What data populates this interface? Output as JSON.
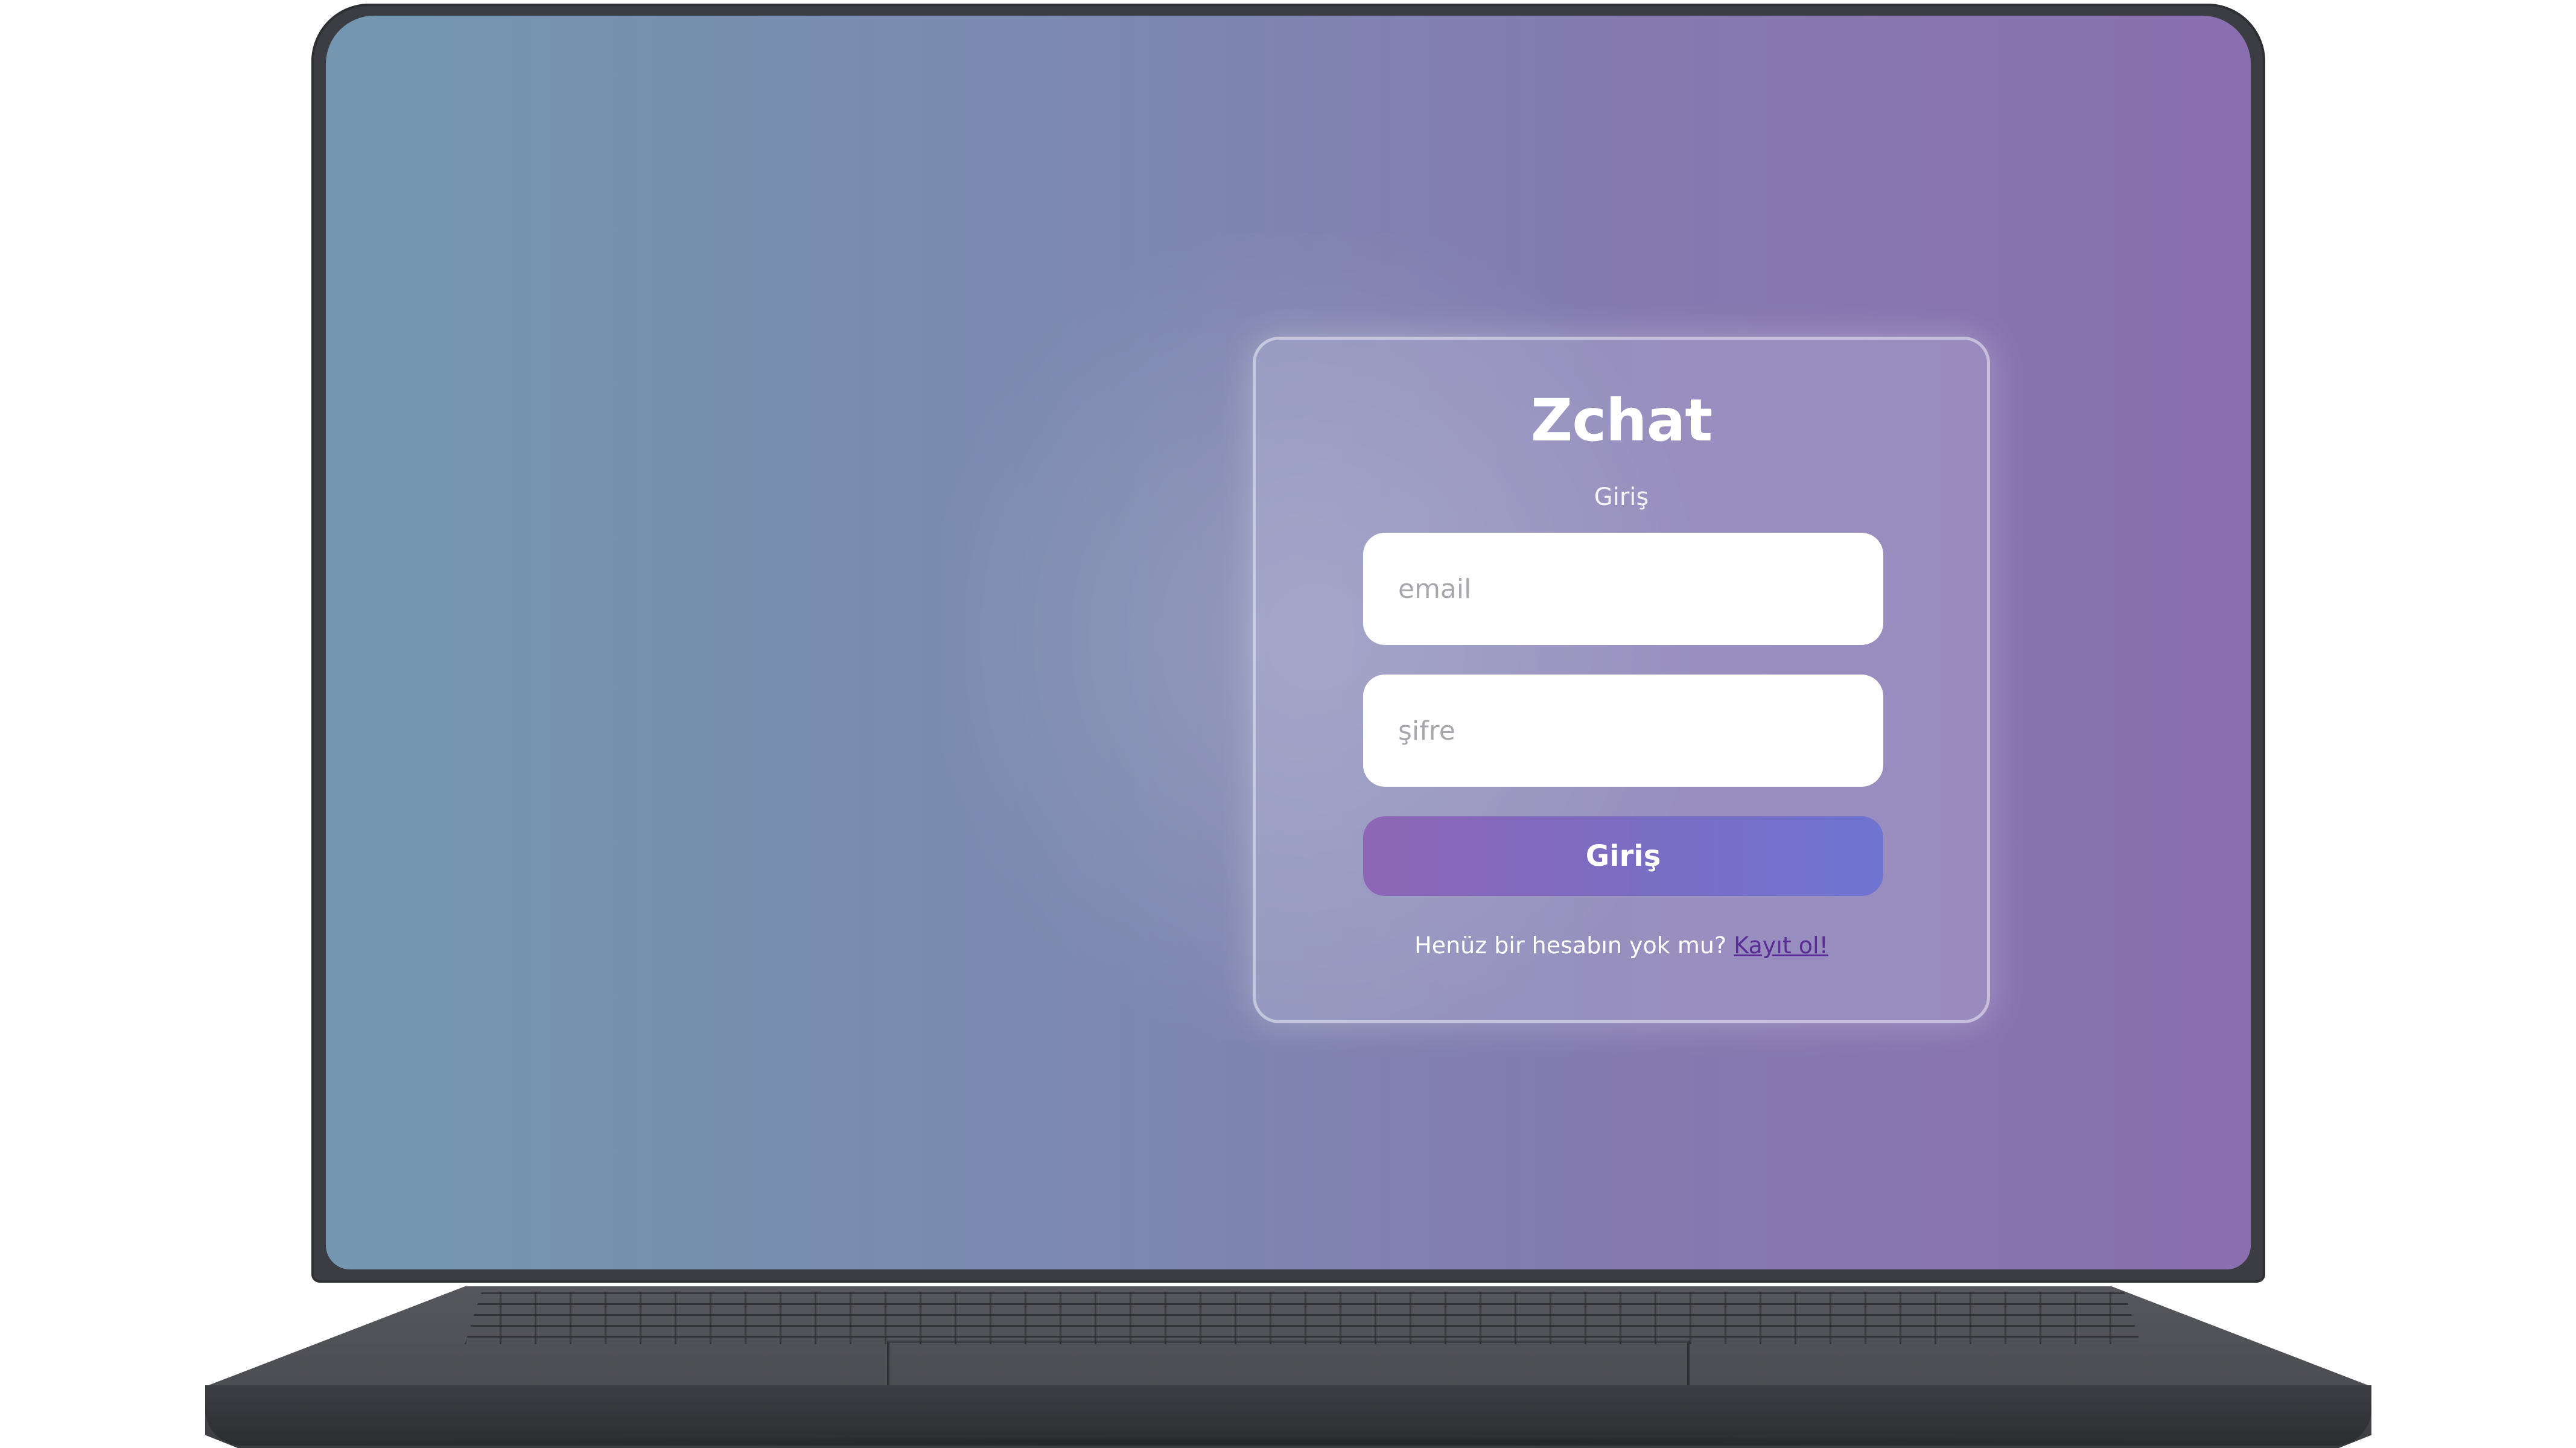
{
  "app": {
    "title": "Zchat",
    "subtitle": "Giriş"
  },
  "form": {
    "email_placeholder": "email",
    "email_value": "",
    "password_placeholder": "şifre",
    "password_value": "",
    "submit_label": "Giriş"
  },
  "register": {
    "prompt": "Henüz bir hesabın yok mu?",
    "link_label": "Kayıt ol!"
  },
  "colors": {
    "background_start": "#7397b0",
    "background_end": "#8a6fb0",
    "button_start": "#8e66b6",
    "button_end": "#6f73d2",
    "link": "#5a2d96"
  }
}
